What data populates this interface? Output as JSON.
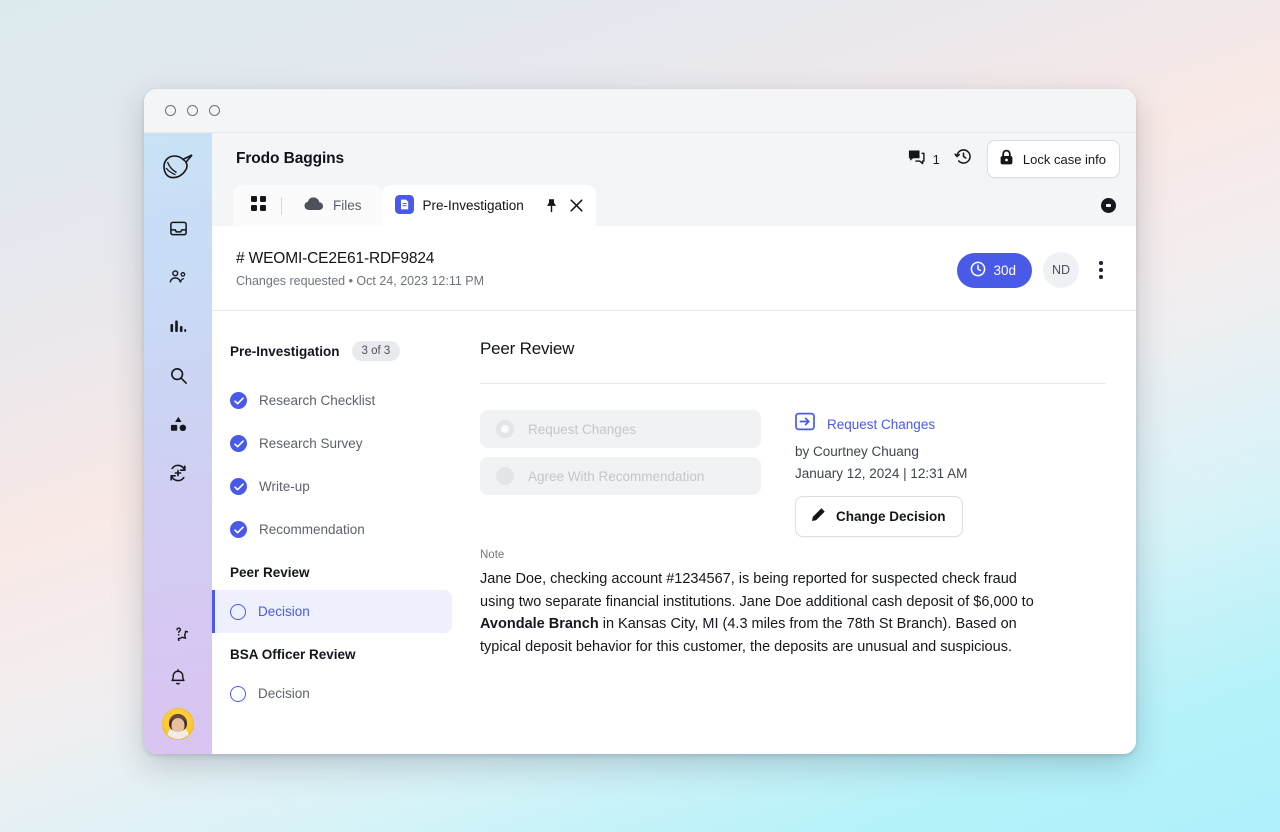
{
  "window": {
    "traffic_dots": [
      "close",
      "minimize",
      "maximize"
    ]
  },
  "topbar": {
    "case_name": "Frodo Baggins",
    "comment_icon": "comments-icon",
    "comment_count": "1",
    "history_icon": "history-icon",
    "lock_icon": "lock-icon",
    "lock_label": "Lock case info"
  },
  "tabs": {
    "grid_icon": "grid-icon",
    "items": [
      {
        "label": "Files",
        "icon": "cloud-icon",
        "active": false
      },
      {
        "label": "Pre-Investigation",
        "icon": "document-icon",
        "active": true
      }
    ],
    "pin_icon": "pin-icon",
    "close_icon": "close-icon",
    "status_icon": "status-dot-icon"
  },
  "case_header": {
    "case_id": "# WEOMI-CE2E61-RDF9824",
    "subtitle": "Changes requested • Oct 24, 2023 12:11 PM",
    "sla_icon": "clock-icon",
    "sla_label": "30d",
    "assignee_initials": "ND",
    "menu_icon": "kebab-menu-icon"
  },
  "checklist": {
    "title": "Pre-Investigation",
    "badge": "3 of 3",
    "completed": [
      {
        "label": "Research Checklist",
        "state": "done"
      },
      {
        "label": "Research Survey",
        "state": "done"
      },
      {
        "label": "Write-up",
        "state": "done"
      },
      {
        "label": "Recommendation",
        "state": "done"
      }
    ],
    "groups": [
      {
        "title": "Peer Review",
        "items": [
          {
            "label": "Decision",
            "state": "active"
          }
        ]
      },
      {
        "title": "BSA Officer Review",
        "items": [
          {
            "label": "Decision",
            "state": "pending"
          }
        ]
      }
    ]
  },
  "content": {
    "title": "Peer Review",
    "options": [
      {
        "label": "Request Changes",
        "selected": true,
        "disabled": true
      },
      {
        "label": "Agree With Recommendation",
        "selected": false,
        "disabled": true
      }
    ],
    "decision": {
      "icon": "request-changes-icon",
      "title": "Request Changes",
      "by": "by Courtney Chuang",
      "when": "January 12, 2024 | 12:31 AM",
      "change_icon": "pencil-icon",
      "change_label": "Change Decision"
    },
    "note": {
      "label": "Note",
      "part1": "Jane Doe, checking account #1234567, is being reported for suspected check fraud using two separate financial institutions. Jane Doe additional cash deposit of $6,000 to ",
      "bold": "Avondale Branch",
      "part2": " in Kansas City, MI (4.3 miles from the 78th St Branch). Based on typical deposit behavior for this customer, the deposits are unusual and suspicious."
    }
  },
  "colors": {
    "accent": "#4a5ae8",
    "text": "#13161d",
    "muted": "#6f757f",
    "panel": "#f4f5f7"
  }
}
